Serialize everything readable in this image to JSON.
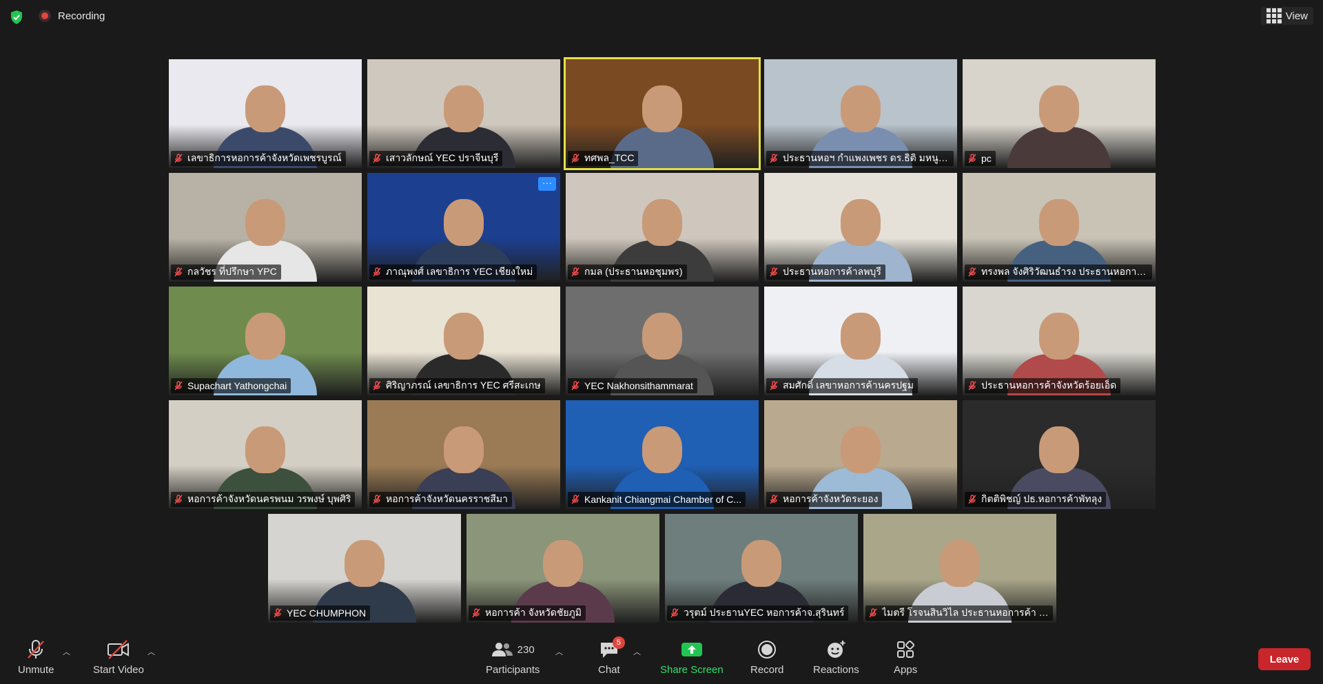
{
  "top": {
    "recording_label": "Recording",
    "view_label": "View"
  },
  "participants": [
    {
      "name": "เลขาธิการหอการค้าจังหวัดเพชรบูรณ์",
      "bg": "#e9e9ef"
    },
    {
      "name": "เสาวลักษณ์ YEC ปราจีนบุรี",
      "bg": "#cfc8be"
    },
    {
      "name": "ทศพล_TCC",
      "bg": "#7a4a22",
      "active": true
    },
    {
      "name": "ประธานหอฯ กำแพงเพชร ดร.ธิติ มหนูญ...",
      "bg": "#b9c3cb"
    },
    {
      "name": "pc",
      "bg": "#d8d4cc"
    },
    {
      "name": "กลวัชร ที่ปรึกษา YPC",
      "bg": "#b8b2a6"
    },
    {
      "name": "ภาณุพงศ์ เลขาธิการ YEC เชียงใหม่",
      "bg": "#1c3f8f",
      "more": true
    },
    {
      "name": "กมล (ประธานหอชุมพร)",
      "bg": "#cfc7bd"
    },
    {
      "name": "ประธานหอการค้าลพบุรี",
      "bg": "#e5e1d8"
    },
    {
      "name": "ทรงพล จังศิริวัฒนธำรง ประธานหอการค้...",
      "bg": "#c9c3b6"
    },
    {
      "name": "Supachart Yathongchai",
      "bg": "#6f8c4e"
    },
    {
      "name": "ศิริญาภรณ์ เลขาธิการ YEC ศรีสะเกษ",
      "bg": "#e9e3d4"
    },
    {
      "name": "YEC Nakhonsithammarat",
      "bg": "#6e6e6e"
    },
    {
      "name": "สมศักดิ์ เลขาหอการค้านครปฐม",
      "bg": "#eef0f4"
    },
    {
      "name": "ประธานหอการค้าจังหวัดร้อยเอ็ด",
      "bg": "#d9d6cf"
    },
    {
      "name": "หอการค้าจังหวัดนครพนม วรพงษ์ บุพศิริ",
      "bg": "#d4cfc4"
    },
    {
      "name": "หอการค้าจังหวัดนครราชสีมา",
      "bg": "#9a7b55"
    },
    {
      "name": "Kankanit Chiangmai Chamber of C...",
      "bg": "#1f5fb4"
    },
    {
      "name": "หอการค้าจังหวัดระยอง",
      "bg": "#b9a98f"
    },
    {
      "name": "กิตติพิชญ์ ปธ.หอการค้าพัทลุง",
      "bg": "#2b2b2b"
    },
    {
      "name": "YEC CHUMPHON",
      "bg": "#d6d4d0"
    },
    {
      "name": "หอการค้า จังหวัดชัยภูมิ",
      "bg": "#8b9579"
    },
    {
      "name": "วรุตม์ ประธานYEC หอการค้าจ.สุรินทร์",
      "bg": "#6e7e7c"
    },
    {
      "name": "ไมตรี โรจนสินวิไล ประธานหอการค้า จัง...",
      "bg": "#a9a68a"
    }
  ],
  "toolbar": {
    "unmute": "Unmute",
    "start_video": "Start Video",
    "participants_count": "230",
    "participants": "Participants",
    "chat_badge": "5",
    "chat": "Chat",
    "share": "Share Screen",
    "record": "Record",
    "reactions": "Reactions",
    "apps": "Apps",
    "leave": "Leave"
  }
}
